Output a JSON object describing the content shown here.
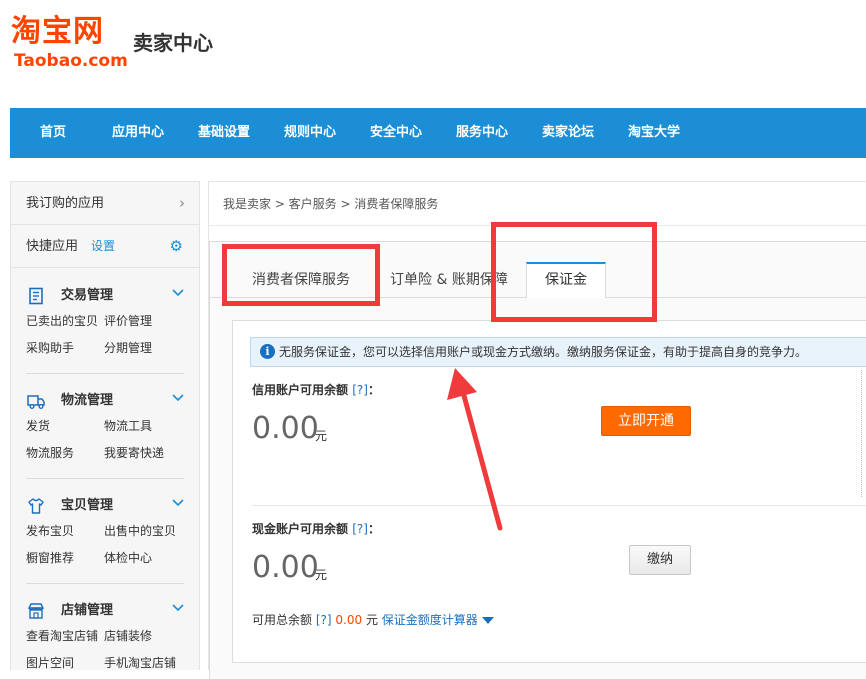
{
  "header": {
    "logo_cn": "淘宝网",
    "logo_en": "Taobao.com",
    "title": "卖家中心"
  },
  "nav": {
    "items": [
      {
        "label": "首页"
      },
      {
        "label": "应用中心"
      },
      {
        "label": "基础设置"
      },
      {
        "label": "规则中心"
      },
      {
        "label": "安全中心"
      },
      {
        "label": "服务中心"
      },
      {
        "label": "卖家论坛"
      },
      {
        "label": "淘宝大学"
      }
    ]
  },
  "sidebar": {
    "subscribed_apps": "我订购的应用",
    "arrow": "›",
    "quick_apps": "快捷应用",
    "setting": "设置",
    "groups": [
      {
        "title": "交易管理",
        "icon": "document-icon",
        "links": [
          "已卖出的宝贝",
          "评价管理",
          "采购助手",
          "分期管理"
        ]
      },
      {
        "title": "物流管理",
        "icon": "truck-icon",
        "links": [
          "发货",
          "物流工具",
          "物流服务",
          "我要寄快递"
        ]
      },
      {
        "title": "宝贝管理",
        "icon": "shirt-icon",
        "links": [
          "发布宝贝",
          "出售中的宝贝",
          "橱窗推荐",
          "体检中心"
        ]
      },
      {
        "title": "店铺管理",
        "icon": "store-icon",
        "links": [
          "查看淘宝店铺",
          "店铺装修",
          "图片空间",
          "手机淘宝店铺"
        ]
      }
    ]
  },
  "breadcrumb": "我是卖家 > 客户服务 > 消费者保障服务",
  "tabs": [
    {
      "label": "消费者保障服务",
      "active": false
    },
    {
      "label": "订单险 & 账期保障",
      "active": false
    },
    {
      "label": "保证金",
      "active": true
    }
  ],
  "info": {
    "icon": "i",
    "text": "无服务保证金，您可以选择信用账户或现金方式缴纳。缴纳服务保证金，有助于提高自身的竞争力。"
  },
  "credit": {
    "label": "信用账户可用余额",
    "help": "[?]",
    "colon": "：",
    "amount": "0.00",
    "unit": "元",
    "button": "立即开通"
  },
  "cash": {
    "label": "现金账户可用余额",
    "help": "[?]",
    "colon": "：",
    "amount": "0.00",
    "unit": "元",
    "button": "缴纳"
  },
  "footer": {
    "label": "可用总余额",
    "help": "[?]",
    "amount": "0.00",
    "unit": "元",
    "calculator": "保证金额度计算器"
  },
  "colors": {
    "nav_blue": "#1b8ed6",
    "brand_orange": "#ff4400",
    "button_orange": "#ff6a00",
    "annotation_red": "#ef3b3b"
  }
}
